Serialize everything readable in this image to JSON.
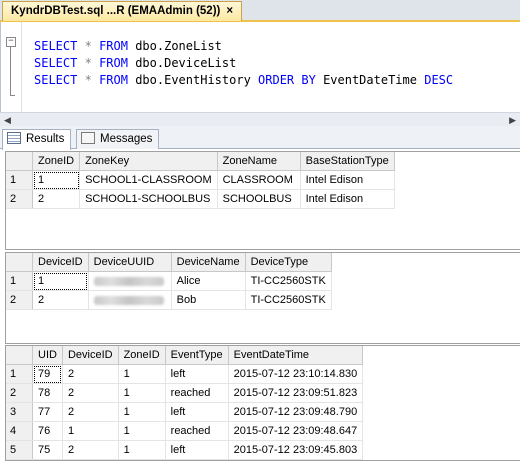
{
  "document_tab": {
    "title": "KyndrDBTest.sql ...R (EMAAdmin (52))",
    "close": "×"
  },
  "editor": {
    "line1": {
      "kw1": "SELECT",
      "star": "*",
      "kw2": "FROM",
      "table": "dbo.ZoneList"
    },
    "line2": {
      "kw1": "SELECT",
      "star": "*",
      "kw2": "FROM",
      "table": "dbo.DeviceList"
    },
    "line3": {
      "kw1": "SELECT",
      "star": "*",
      "kw2": "FROM",
      "table": "dbo.EventHistory",
      "kw3": "ORDER BY",
      "col": "EventDateTime",
      "kw4": "DESC"
    },
    "collapse_glyph": "−"
  },
  "results_tabs": {
    "results": "Results",
    "messages": "Messages"
  },
  "zones": {
    "headers": [
      "ZoneID",
      "ZoneKey",
      "ZoneName",
      "BaseStationType"
    ],
    "rows": [
      {
        "n": "1",
        "ZoneID": "1",
        "ZoneKey": "SCHOOL1-CLASSROOM",
        "ZoneName": "CLASSROOM",
        "BaseStationType": "Intel Edison"
      },
      {
        "n": "2",
        "ZoneID": "2",
        "ZoneKey": "SCHOOL1-SCHOOLBUS",
        "ZoneName": "SCHOOLBUS",
        "BaseStationType": "Intel Edison"
      }
    ]
  },
  "devices": {
    "headers": [
      "DeviceID",
      "DeviceUUID",
      "DeviceName",
      "DeviceType"
    ],
    "rows": [
      {
        "n": "1",
        "DeviceID": "1",
        "DeviceName": "Alice",
        "DeviceType": "TI-CC2560STK"
      },
      {
        "n": "2",
        "DeviceID": "2",
        "DeviceName": "Bob",
        "DeviceType": "TI-CC2560STK"
      }
    ]
  },
  "events": {
    "headers": [
      "UID",
      "DeviceID",
      "ZoneID",
      "EventType",
      "EventDateTime"
    ],
    "rows": [
      {
        "n": "1",
        "UID": "79",
        "DeviceID": "2",
        "ZoneID": "1",
        "EventType": "left",
        "EventDateTime": "2015-07-12 23:10:14.830"
      },
      {
        "n": "2",
        "UID": "78",
        "DeviceID": "2",
        "ZoneID": "1",
        "EventType": "reached",
        "EventDateTime": "2015-07-12 23:09:51.823"
      },
      {
        "n": "3",
        "UID": "77",
        "DeviceID": "2",
        "ZoneID": "1",
        "EventType": "left",
        "EventDateTime": "2015-07-12 23:09:48.790"
      },
      {
        "n": "4",
        "UID": "76",
        "DeviceID": "1",
        "ZoneID": "1",
        "EventType": "reached",
        "EventDateTime": "2015-07-12 23:09:48.647"
      },
      {
        "n": "5",
        "UID": "75",
        "DeviceID": "2",
        "ZoneID": "1",
        "EventType": "left",
        "EventDateTime": "2015-07-12 23:09:45.803"
      }
    ]
  },
  "colors": {
    "keyword": "#0000ff",
    "operator": "#808080",
    "tab_accent": "#f0c24a"
  }
}
